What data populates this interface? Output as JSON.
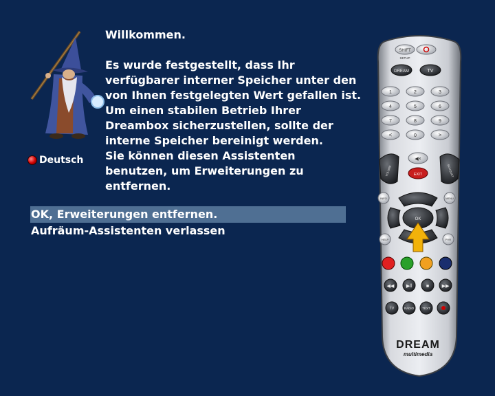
{
  "language": {
    "label": "Deutsch",
    "indicator_color": "#d00000"
  },
  "wizard": {
    "icon": "wizard-icon"
  },
  "message": {
    "title": "Willkommen.",
    "lines": [
      "Es wurde festgestellt, dass Ihr",
      "verfügbarer interner Speicher unter den",
      "von Ihnen festgelegten Wert gefallen ist.",
      "Um einen stabilen Betrieb Ihrer",
      "Dreambox sicherzustellen, sollte der",
      "interne Speicher bereinigt werden.",
      "Sie können diesen Assistenten",
      "benutzen, um Erweiterungen zu",
      "entfernen."
    ]
  },
  "menu": {
    "items": [
      {
        "label": "OK, Erweiterungen entfernen.",
        "selected": true
      },
      {
        "label": "Aufräum-Assistenten verlassen",
        "selected": false
      }
    ]
  },
  "remote": {
    "brand": "DREAM",
    "subbrand": "multimedia",
    "buttons": {
      "shift": "SHIFT",
      "setup": "SETUP",
      "dream": "DREAM",
      "tv": "TV",
      "digits": [
        "1",
        "2",
        "3",
        "4",
        "5",
        "6",
        "7",
        "8",
        "9",
        "0"
      ],
      "exit": "EXIT",
      "ok": "OK",
      "volume": "VOLUME",
      "bouquet": "BOUQUET",
      "info": "INFO",
      "menu": "MENU",
      "help": "HELP",
      "pvr": "PVR",
      "tv_small": "TV",
      "radio": "RADIO",
      "text": "TEXT"
    },
    "colors": {
      "red": "#e02020",
      "green": "#2aa02a",
      "yellow": "#f0a020",
      "blue": "#1a2e6e",
      "arrow": "#f2b20a"
    }
  },
  "colors": {
    "background": "#0b2650",
    "selection": "#4f6f93",
    "text": "#ffffff"
  }
}
